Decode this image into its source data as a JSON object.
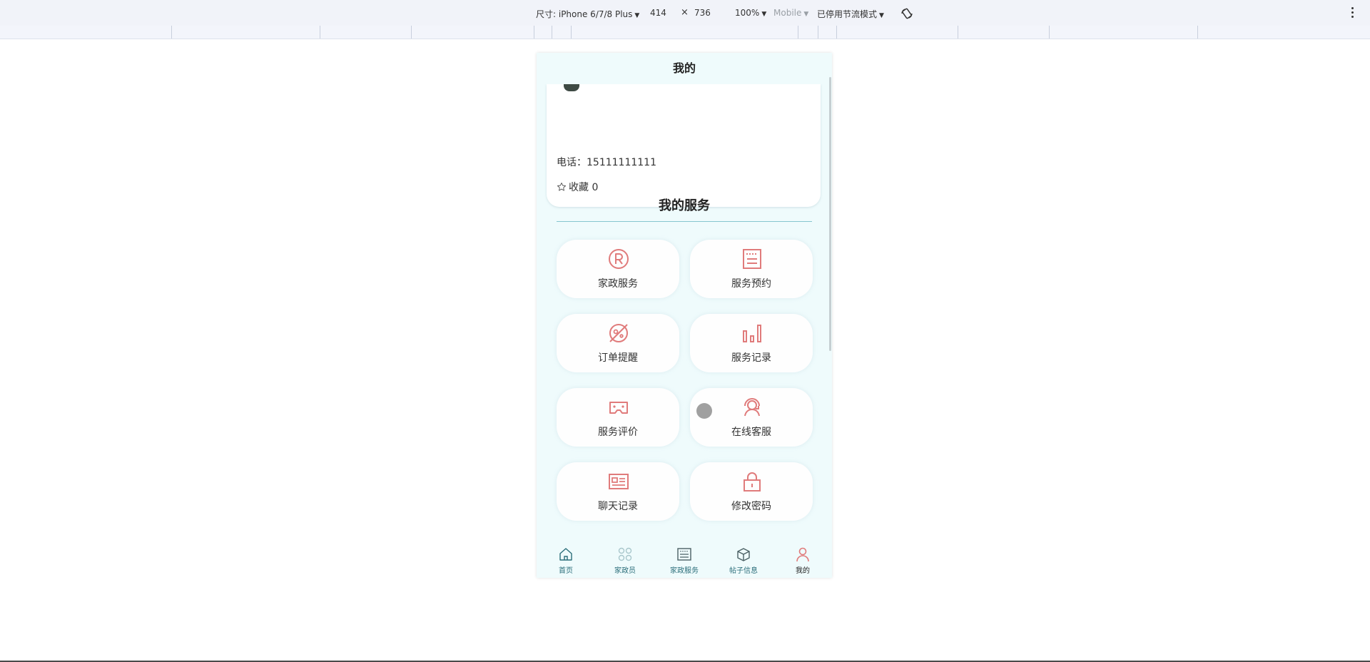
{
  "devtools": {
    "size_label": "尺寸: iPhone 6/7/8 Plus",
    "width": "414",
    "times": "×",
    "height": "736",
    "zoom": "100%",
    "mobile": "Mobile",
    "throttle": "已停用节流模式",
    "rotate_icon": "rotate-icon",
    "more_icon": "more-icon"
  },
  "page": {
    "title": "我的",
    "phone_text": "电话：15111111111",
    "favorites_text": "收藏 0",
    "section_title": "我的服务"
  },
  "services": [
    {
      "label": "家政服务",
      "icon": "registered-icon"
    },
    {
      "label": "服务预约",
      "icon": "notes-icon"
    },
    {
      "label": "订单提醒",
      "icon": "planet-icon"
    },
    {
      "label": "服务记录",
      "icon": "bar-chart-icon"
    },
    {
      "label": "服务评价",
      "icon": "vr-glasses-icon"
    },
    {
      "label": "在线客服",
      "icon": "customer-service-icon"
    },
    {
      "label": "聊天记录",
      "icon": "id-card-icon"
    },
    {
      "label": "修改密码",
      "icon": "lock-icon"
    }
  ],
  "tabs": [
    {
      "label": "首页",
      "icon": "home-icon"
    },
    {
      "label": "家政员",
      "icon": "grid-icon"
    },
    {
      "label": "家政服务",
      "icon": "calendar-icon"
    },
    {
      "label": "帖子信息",
      "icon": "box-icon"
    },
    {
      "label": "我的",
      "icon": "user-icon",
      "active": true
    }
  ],
  "colors": {
    "accent": "#e07b7b",
    "page_bg": "#effbfc",
    "tab_text": "#2b6e7a",
    "divider": "#86c6cf"
  }
}
